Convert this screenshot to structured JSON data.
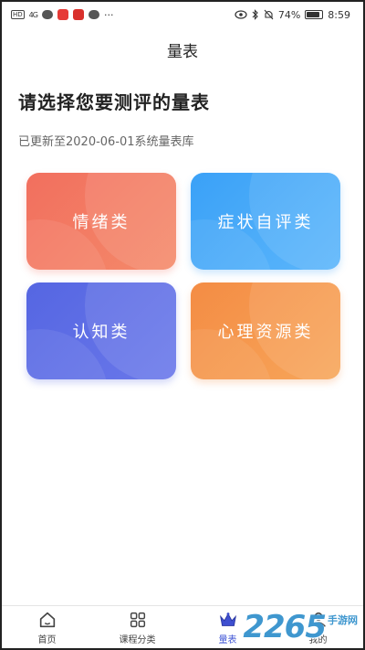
{
  "status_bar": {
    "hd": "HD",
    "signal": "4G",
    "battery": "74%",
    "time": "8:59"
  },
  "header": {
    "title": "量表"
  },
  "main": {
    "heading": "请选择您要测评的量表",
    "update_note": "已更新至2020-06-01系统量表库",
    "cards": [
      {
        "label": "情绪类",
        "color": "#f26f5e"
      },
      {
        "label": "症状自评类",
        "color": "#3aa1f7"
      },
      {
        "label": "认知类",
        "color": "#5566e2"
      },
      {
        "label": "心理资源类",
        "color": "#f48c44"
      }
    ]
  },
  "tab_bar": {
    "active_color": "#4257d6",
    "tabs": [
      {
        "label": "首页",
        "icon": "home-icon"
      },
      {
        "label": "课程分类",
        "icon": "grid-icon"
      },
      {
        "label": "量表",
        "icon": "crown-icon",
        "active": true
      },
      {
        "label": "我的",
        "icon": "user-icon"
      }
    ]
  },
  "watermark": {
    "number": "2265",
    "text": "手游网"
  }
}
